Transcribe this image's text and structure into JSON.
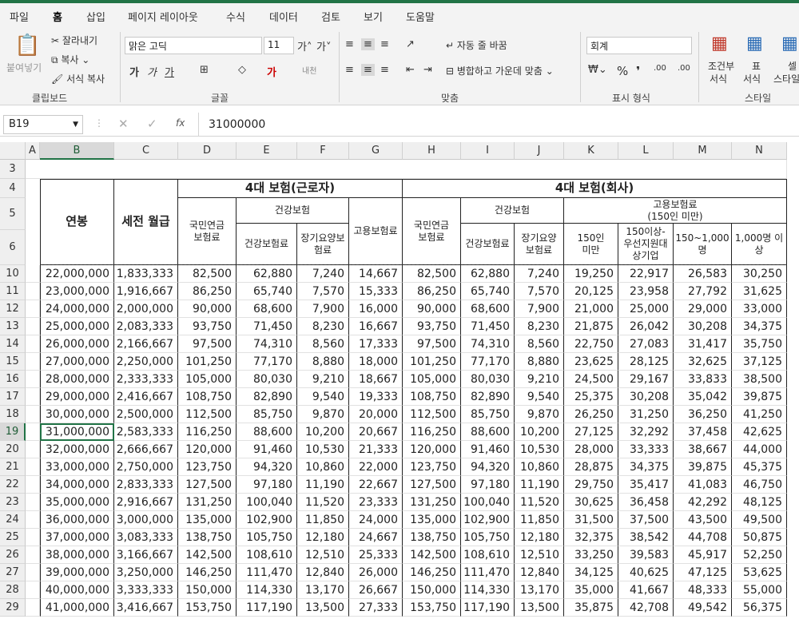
{
  "tabs": [
    "파일",
    "홈",
    "삽입",
    "페이지 레이아웃",
    "수식",
    "데이터",
    "검토",
    "보기",
    "도움말"
  ],
  "ribbon": {
    "paste": "붙여넣기",
    "cut": "잘라내기",
    "copy": "복사",
    "format_copy": "서식 복사",
    "clipboard": "클립보드",
    "font_name": "맑은 고딕",
    "font_size": "11",
    "font_group": "글꼴",
    "wrap": "자동 줄 바꿈",
    "merge": "병합하고 가운데 맞춤",
    "align_group": "맞춤",
    "number_format": "회계",
    "number_group": "표시 형식",
    "cond1": "조건부",
    "cond2": "서식",
    "table1": "표",
    "table2": "서식",
    "cell1": "셀",
    "cell2": "스타일",
    "style_group": "스타일"
  },
  "formula_bar": {
    "name_box": "B19",
    "fx": "fx",
    "value": "31000000"
  },
  "columns": [
    "A",
    "B",
    "C",
    "D",
    "E",
    "F",
    "G",
    "H",
    "I",
    "J",
    "K",
    "L",
    "M",
    "N"
  ],
  "header": {
    "group_worker": "4대 보험(근로자)",
    "group_company": "4대 보험(회사)",
    "salary": "연봉",
    "monthly": "세전 월급",
    "pension": "국민연금\n보험료",
    "health": "건강보험",
    "health_fee": "건강보험료",
    "ltc": "장기요양보험료",
    "employment": "고용보험료",
    "pension_c": "국민연금\n보험료",
    "health_c": "건강보험",
    "health_fee_c": "건강보험료",
    "ltc_c": "장기요양\n보험료",
    "emp_c": "고용보험료\n(150인 미만)",
    "k": "150인\n미만",
    "l": "150이상-\n우선지원대\n상기업",
    "m": "150~1,000\n명",
    "n": "1,000명 이\n상"
  },
  "rows": [
    {
      "n": "10",
      "v": [
        "22,000,000",
        "1,833,333",
        "82,500",
        "62,880",
        "7,240",
        "14,667",
        "82,500",
        "62,880",
        "7,240",
        "19,250",
        "22,917",
        "26,583",
        "30,250"
      ]
    },
    {
      "n": "11",
      "v": [
        "23,000,000",
        "1,916,667",
        "86,250",
        "65,740",
        "7,570",
        "15,333",
        "86,250",
        "65,740",
        "7,570",
        "20,125",
        "23,958",
        "27,792",
        "31,625"
      ]
    },
    {
      "n": "12",
      "v": [
        "24,000,000",
        "2,000,000",
        "90,000",
        "68,600",
        "7,900",
        "16,000",
        "90,000",
        "68,600",
        "7,900",
        "21,000",
        "25,000",
        "29,000",
        "33,000"
      ]
    },
    {
      "n": "13",
      "v": [
        "25,000,000",
        "2,083,333",
        "93,750",
        "71,450",
        "8,230",
        "16,667",
        "93,750",
        "71,450",
        "8,230",
        "21,875",
        "26,042",
        "30,208",
        "34,375"
      ]
    },
    {
      "n": "14",
      "v": [
        "26,000,000",
        "2,166,667",
        "97,500",
        "74,310",
        "8,560",
        "17,333",
        "97,500",
        "74,310",
        "8,560",
        "22,750",
        "27,083",
        "31,417",
        "35,750"
      ]
    },
    {
      "n": "15",
      "v": [
        "27,000,000",
        "2,250,000",
        "101,250",
        "77,170",
        "8,880",
        "18,000",
        "101,250",
        "77,170",
        "8,880",
        "23,625",
        "28,125",
        "32,625",
        "37,125"
      ]
    },
    {
      "n": "16",
      "v": [
        "28,000,000",
        "2,333,333",
        "105,000",
        "80,030",
        "9,210",
        "18,667",
        "105,000",
        "80,030",
        "9,210",
        "24,500",
        "29,167",
        "33,833",
        "38,500"
      ]
    },
    {
      "n": "17",
      "v": [
        "29,000,000",
        "2,416,667",
        "108,750",
        "82,890",
        "9,540",
        "19,333",
        "108,750",
        "82,890",
        "9,540",
        "25,375",
        "30,208",
        "35,042",
        "39,875"
      ]
    },
    {
      "n": "18",
      "v": [
        "30,000,000",
        "2,500,000",
        "112,500",
        "85,750",
        "9,870",
        "20,000",
        "112,500",
        "85,750",
        "9,870",
        "26,250",
        "31,250",
        "36,250",
        "41,250"
      ]
    },
    {
      "n": "19",
      "v": [
        "31,000,000",
        "2,583,333",
        "116,250",
        "88,600",
        "10,200",
        "20,667",
        "116,250",
        "88,600",
        "10,200",
        "27,125",
        "32,292",
        "37,458",
        "42,625"
      ]
    },
    {
      "n": "20",
      "v": [
        "32,000,000",
        "2,666,667",
        "120,000",
        "91,460",
        "10,530",
        "21,333",
        "120,000",
        "91,460",
        "10,530",
        "28,000",
        "33,333",
        "38,667",
        "44,000"
      ]
    },
    {
      "n": "21",
      "v": [
        "33,000,000",
        "2,750,000",
        "123,750",
        "94,320",
        "10,860",
        "22,000",
        "123,750",
        "94,320",
        "10,860",
        "28,875",
        "34,375",
        "39,875",
        "45,375"
      ]
    },
    {
      "n": "22",
      "v": [
        "34,000,000",
        "2,833,333",
        "127,500",
        "97,180",
        "11,190",
        "22,667",
        "127,500",
        "97,180",
        "11,190",
        "29,750",
        "35,417",
        "41,083",
        "46,750"
      ]
    },
    {
      "n": "23",
      "v": [
        "35,000,000",
        "2,916,667",
        "131,250",
        "100,040",
        "11,520",
        "23,333",
        "131,250",
        "100,040",
        "11,520",
        "30,625",
        "36,458",
        "42,292",
        "48,125"
      ]
    },
    {
      "n": "24",
      "v": [
        "36,000,000",
        "3,000,000",
        "135,000",
        "102,900",
        "11,850",
        "24,000",
        "135,000",
        "102,900",
        "11,850",
        "31,500",
        "37,500",
        "43,500",
        "49,500"
      ]
    },
    {
      "n": "25",
      "v": [
        "37,000,000",
        "3,083,333",
        "138,750",
        "105,750",
        "12,180",
        "24,667",
        "138,750",
        "105,750",
        "12,180",
        "32,375",
        "38,542",
        "44,708",
        "50,875"
      ]
    },
    {
      "n": "26",
      "v": [
        "38,000,000",
        "3,166,667",
        "142,500",
        "108,610",
        "12,510",
        "25,333",
        "142,500",
        "108,610",
        "12,510",
        "33,250",
        "39,583",
        "45,917",
        "52,250"
      ]
    },
    {
      "n": "27",
      "v": [
        "39,000,000",
        "3,250,000",
        "146,250",
        "111,470",
        "12,840",
        "26,000",
        "146,250",
        "111,470",
        "12,840",
        "34,125",
        "40,625",
        "47,125",
        "53,625"
      ]
    },
    {
      "n": "28",
      "v": [
        "40,000,000",
        "3,333,333",
        "150,000",
        "114,330",
        "13,170",
        "26,667",
        "150,000",
        "114,330",
        "13,170",
        "35,000",
        "41,667",
        "48,333",
        "55,000"
      ]
    },
    {
      "n": "29",
      "v": [
        "41,000,000",
        "3,416,667",
        "153,750",
        "117,190",
        "13,500",
        "27,333",
        "153,750",
        "117,190",
        "13,500",
        "35,875",
        "42,708",
        "49,542",
        "56,375"
      ]
    }
  ]
}
